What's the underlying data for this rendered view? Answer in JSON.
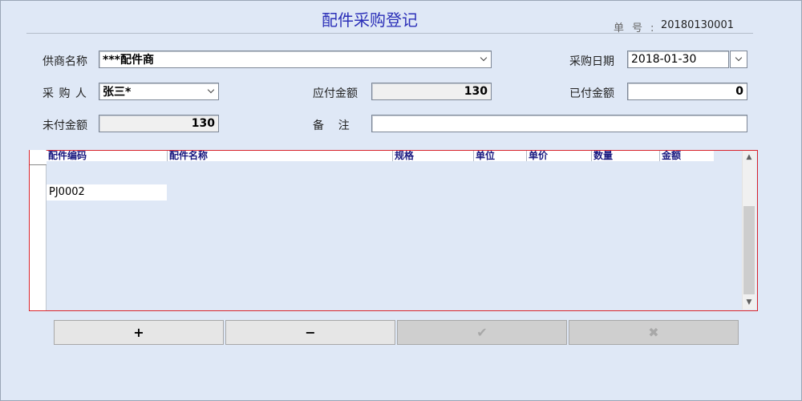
{
  "header": {
    "title": "配件采购登记",
    "order_no_label": "单号:",
    "order_no_value": "20180130001"
  },
  "form": {
    "supplier": {
      "label": "供商名称",
      "value": "***配件商"
    },
    "purchase_date": {
      "label": "采购日期",
      "value": "2018-01-30"
    },
    "buyer": {
      "label": "采 购 人",
      "value": "张三*"
    },
    "payable": {
      "label": "应付金额",
      "value": "130"
    },
    "paid": {
      "label": "已付金额",
      "value": "0"
    },
    "unpaid": {
      "label": "未付金额",
      "value": "130"
    },
    "remark": {
      "label": "备    注",
      "value": ""
    }
  },
  "grid": {
    "columns": [
      "配件编码",
      "配件名称",
      "规格",
      "单位",
      "单价",
      "数量",
      "金额"
    ],
    "rows": [
      [
        "PJ0002",
        "",
        "",
        "",
        "",
        "",
        ""
      ]
    ]
  },
  "buttons": {
    "add": "+",
    "remove": "−",
    "confirm": "✔",
    "cancel": "✖"
  }
}
